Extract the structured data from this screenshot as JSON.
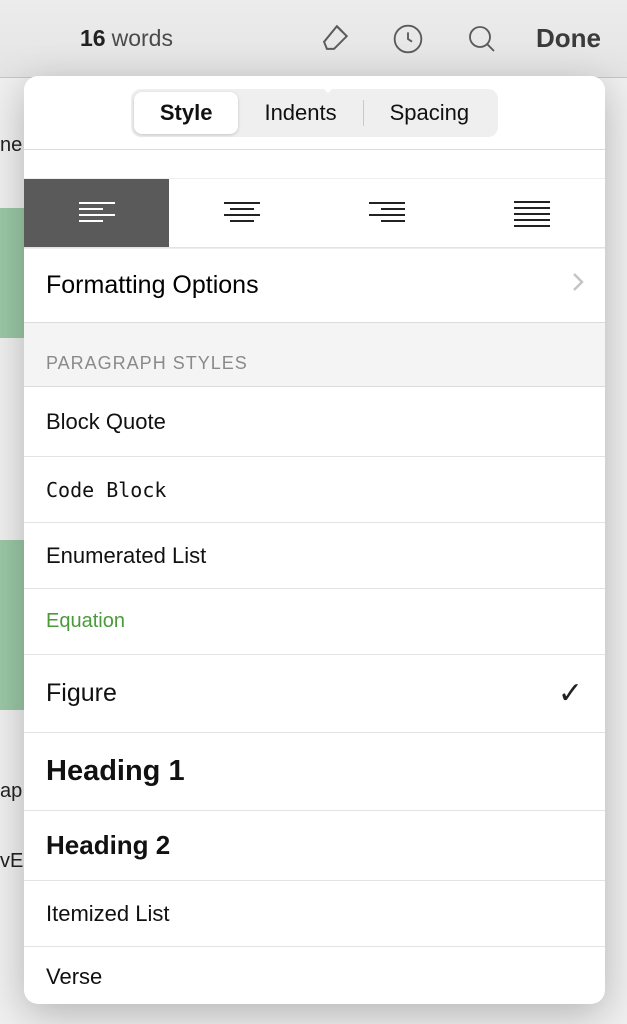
{
  "toolbar": {
    "word_count_number": "16",
    "word_count_label": "words",
    "done_label": "Done"
  },
  "background_fragments": {
    "f1": "ne",
    "f2": "ap",
    "f3": "vE"
  },
  "popover": {
    "tabs": {
      "style": "Style",
      "indents": "Indents",
      "spacing": "Spacing",
      "active": "style"
    },
    "alignment": {
      "selected": "left",
      "options": [
        "left",
        "center",
        "right",
        "justify"
      ]
    },
    "formatting_options_label": "Formatting Options",
    "section_header": "PARAGRAPH STYLES",
    "styles": [
      {
        "label": "Block Quote",
        "klass": "hi-70",
        "checked": false
      },
      {
        "label": "Code Block",
        "klass": "mono hi-66",
        "checked": false
      },
      {
        "label": "Enumerated List",
        "klass": "hi-66",
        "checked": false
      },
      {
        "label": "Equation",
        "klass": "equation hi-66",
        "checked": false
      },
      {
        "label": "Figure",
        "klass": "figure hi-78",
        "checked": true
      },
      {
        "label": "Heading 1",
        "klass": "h1 hi-78",
        "checked": false
      },
      {
        "label": "Heading 2",
        "klass": "h2 hi-70",
        "checked": false
      },
      {
        "label": "Itemized List",
        "klass": "hi-66",
        "checked": false
      },
      {
        "label": "Verse",
        "klass": "hi-60",
        "checked": false
      }
    ]
  }
}
